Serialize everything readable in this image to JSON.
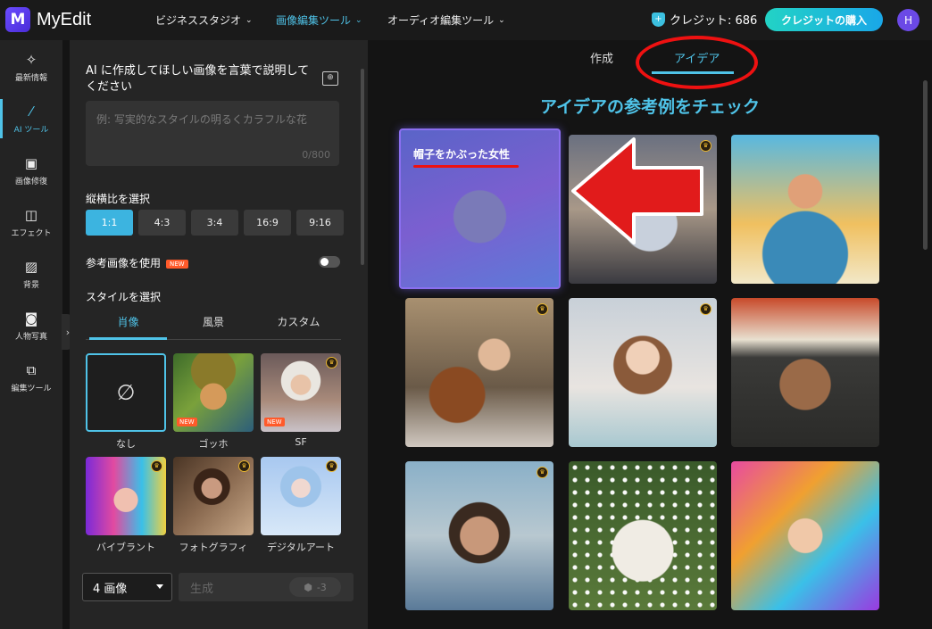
{
  "app": {
    "name": "MyEdit",
    "logo_letter": "M"
  },
  "topnav": [
    {
      "label": "ビジネススタジオ",
      "active": false
    },
    {
      "label": "画像編集ツール",
      "active": true
    },
    {
      "label": "オーディオ編集ツール",
      "active": false
    }
  ],
  "credit": {
    "label": "クレジット: 686"
  },
  "buy_button": "クレジットの購入",
  "user_initial": "H",
  "rail": [
    {
      "label": "最新情報",
      "icon": "sparkle-icon",
      "glyph": "✧"
    },
    {
      "label": "AI ツール",
      "icon": "magic-wand-icon",
      "glyph": "⚚",
      "active": true
    },
    {
      "label": "画像修復",
      "icon": "image-repair-icon",
      "glyph": "▣"
    },
    {
      "label": "エフェクト",
      "icon": "effect-icon",
      "glyph": "◫"
    },
    {
      "label": "背景",
      "icon": "background-icon",
      "glyph": "▨"
    },
    {
      "label": "人物写真",
      "icon": "portrait-icon",
      "glyph": "◙"
    },
    {
      "label": "編集ツール",
      "icon": "edit-tools-icon",
      "glyph": "⧉"
    }
  ],
  "panel": {
    "prompt_title": "AI に作成してほしい画像を言葉で説明してください",
    "prompt_placeholder": "例: 写実的なスタイルの明るくカラフルな花",
    "prompt_count": "0/800",
    "ratio_label": "縦横比を選択",
    "ratios": [
      "1:1",
      "4:3",
      "3:4",
      "16:9",
      "9:16"
    ],
    "ratio_selected": "1:1",
    "reference_label": "参考画像を使用",
    "new_badge": "NEW",
    "reference_enabled": false,
    "style_label": "スタイルを選択",
    "style_tabs": [
      "肖像",
      "風景",
      "カスタム"
    ],
    "style_tab_active": "肖像",
    "styles": [
      {
        "name": "なし",
        "glyph": "∅",
        "selected": true
      },
      {
        "name": "ゴッホ",
        "badge": "NEW"
      },
      {
        "name": "SF",
        "badge": "NEW",
        "premium": true
      },
      {
        "name": "バイブラント",
        "premium": true
      },
      {
        "name": "フォトグラフィ",
        "premium": true
      },
      {
        "name": "デジタルアート",
        "premium": true
      }
    ],
    "count_select": "4 画像",
    "generate_label": "生成",
    "generate_cost": "-3"
  },
  "main": {
    "tabs": [
      "作成",
      "アイデア"
    ],
    "active_tab": "アイデア",
    "heading": "アイデアの参考例をチェック",
    "cards": [
      {
        "label": "帽子をかぶった女性",
        "featured": true
      },
      {
        "premium": true
      },
      {},
      {
        "premium": true
      },
      {
        "premium": true
      },
      {},
      {
        "premium": true
      },
      {},
      {}
    ]
  }
}
